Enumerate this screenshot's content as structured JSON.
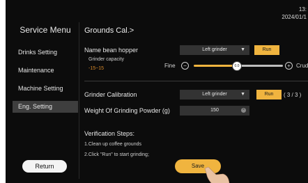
{
  "clock": {
    "time": "13:",
    "date": "2024/01/1"
  },
  "sidebar": {
    "title": "Service Menu",
    "items": [
      {
        "label": "Drinks Setting"
      },
      {
        "label": "Maintenance"
      },
      {
        "label": "Machine Setting"
      },
      {
        "label": "Eng. Setting"
      }
    ],
    "active_index": 3,
    "return_label": "Return"
  },
  "main": {
    "title": "Grounds Cal.>",
    "hopper": {
      "label": "Name bean hopper",
      "selected": "Left grinder",
      "run_label": "Run"
    },
    "capacity": {
      "label": "Grinder capacity",
      "range": "-15~15",
      "fine_label": "Fine",
      "coarse_label": "Crud",
      "value": "0.0",
      "min": -15,
      "max": 15,
      "current": 0
    },
    "calibration": {
      "label": "Grinder Calibration",
      "selected": "Left grinder",
      "run_label": "Run",
      "count": "( 3 / 3 )"
    },
    "weight": {
      "label": "Weight Of Grinding Powder (g)",
      "value": "150"
    },
    "verification": {
      "title": "Verification Steps:",
      "step1": "1.Clean up coffee grounds",
      "step2": "2.Click \"Run\" to start grinding;"
    },
    "save_label": "Save"
  },
  "colors": {
    "accent": "#f0b43f",
    "range": "#d8892a",
    "background": "#0c0c0c",
    "field": "#333333"
  },
  "icons": {
    "dropdown": "chevron-down-icon",
    "minus": "minus-circle-icon",
    "plus": "plus-circle-icon",
    "clear": "clear-icon"
  }
}
